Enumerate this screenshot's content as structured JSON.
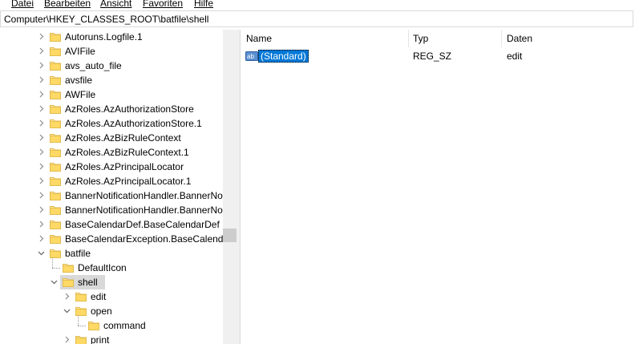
{
  "menu": [
    "Datei",
    "Bearbeiten",
    "Ansicht",
    "Favoriten",
    "Hilfe"
  ],
  "address": "Computer\\HKEY_CLASSES_ROOT\\batfile\\shell",
  "tree": {
    "items": [
      {
        "label": "Autoruns.Logfile.1",
        "expander": "collapsed"
      },
      {
        "label": "AVIFile",
        "expander": "collapsed"
      },
      {
        "label": "avs_auto_file",
        "expander": "collapsed"
      },
      {
        "label": "avsfile",
        "expander": "collapsed"
      },
      {
        "label": "AWFile",
        "expander": "collapsed"
      },
      {
        "label": "AzRoles.AzAuthorizationStore",
        "expander": "collapsed"
      },
      {
        "label": "AzRoles.AzAuthorizationStore.1",
        "expander": "collapsed"
      },
      {
        "label": "AzRoles.AzBizRuleContext",
        "expander": "collapsed"
      },
      {
        "label": "AzRoles.AzBizRuleContext.1",
        "expander": "collapsed"
      },
      {
        "label": "AzRoles.AzPrincipalLocator",
        "expander": "collapsed"
      },
      {
        "label": "AzRoles.AzPrincipalLocator.1",
        "expander": "collapsed"
      },
      {
        "label": "BannerNotificationHandler.BannerNo",
        "expander": "collapsed"
      },
      {
        "label": "BannerNotificationHandler.BannerNo",
        "expander": "collapsed"
      },
      {
        "label": "BaseCalendarDef.BaseCalendarDef",
        "expander": "collapsed"
      },
      {
        "label": "BaseCalendarException.BaseCalenda",
        "expander": "collapsed"
      },
      {
        "label": "batfile",
        "expander": "expanded"
      },
      {
        "label": "DefaultIcon",
        "expander": "none"
      },
      {
        "label": "shell",
        "expander": "expanded",
        "selected": true
      },
      {
        "label": "edit",
        "expander": "collapsed"
      },
      {
        "label": "open",
        "expander": "expanded"
      },
      {
        "label": "command",
        "expander": "none"
      },
      {
        "label": "print",
        "expander": "collapsed"
      }
    ]
  },
  "values_pane": {
    "columns": {
      "name": "Name",
      "type": "Typ",
      "data": "Daten"
    },
    "rows": [
      {
        "name": "(Standard)",
        "type": "REG_SZ",
        "data": "edit",
        "icon": "string-value-icon"
      }
    ]
  },
  "colors": {
    "selection": "#0078d7",
    "folder": "#ffe7a0",
    "folder_border": "#e0b84a"
  }
}
